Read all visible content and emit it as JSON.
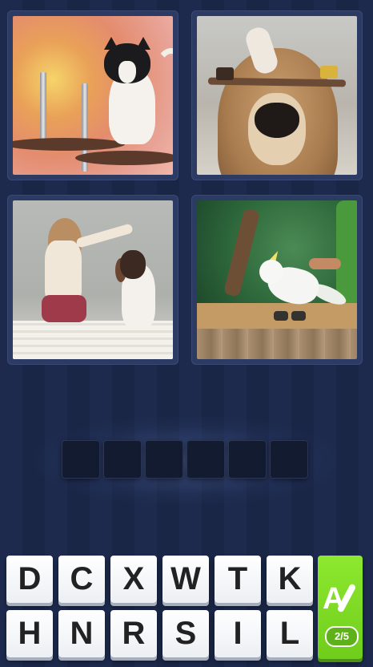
{
  "photos": [
    {
      "subject": "cat on scratching post"
    },
    {
      "subject": "dog balancing treats"
    },
    {
      "subject": "girl with sitting dog"
    },
    {
      "subject": "cockatoo wearing shoes"
    }
  ],
  "answer": {
    "slot_count": 6,
    "filled": [
      "",
      "",
      "",
      "",
      "",
      ""
    ]
  },
  "keyboard": {
    "rows": [
      [
        "D",
        "C",
        "X",
        "W",
        "T",
        "K"
      ],
      [
        "H",
        "N",
        "R",
        "S",
        "I",
        "L"
      ]
    ]
  },
  "hint": {
    "icon": "paintbrush-letter-icon",
    "glyph": "A",
    "count": "2/5"
  },
  "colors": {
    "background": "#1d2a4d",
    "hint": "#7ad925",
    "slot": "#131b30"
  }
}
